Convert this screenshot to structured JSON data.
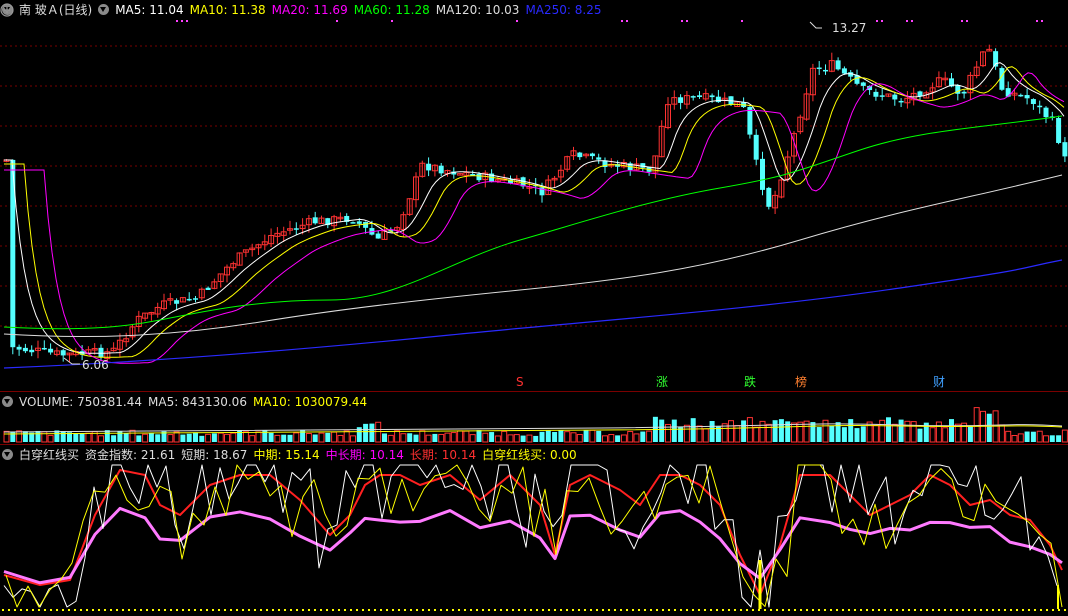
{
  "main": {
    "title": "南 玻Ａ(日线)",
    "ma": [
      {
        "label": "MA5: 11.04",
        "color": "#ffffff"
      },
      {
        "label": "MA10: 11.38",
        "color": "#ffff00"
      },
      {
        "label": "MA20: 11.69",
        "color": "#ff00ff"
      },
      {
        "label": "MA60: 11.28",
        "color": "#00ff00"
      },
      {
        "label": "MA120: 10.03",
        "color": "#dddddd"
      },
      {
        "label": "MA250: 8.25",
        "color": "#1a1aff"
      }
    ],
    "high_label": "13.27",
    "low_label": "6.06",
    "tags": [
      {
        "text": "S",
        "color": "#ff3030"
      },
      {
        "text": "涨",
        "color": "#30ff30"
      },
      {
        "text": "跌",
        "color": "#30ff30"
      },
      {
        "text": "榜",
        "color": "#ff8030"
      },
      {
        "text": "财",
        "color": "#40a0ff"
      }
    ],
    "icons": {
      "collapse": "chevron-down-icon",
      "settings": "expand-icon"
    }
  },
  "volume": {
    "items": [
      {
        "label": "VOLUME: 750381.44",
        "color": "#dddddd"
      },
      {
        "label": "MA5: 843130.06",
        "color": "#dddddd"
      },
      {
        "label": "MA10: 1030079.44",
        "color": "#ffff00"
      }
    ]
  },
  "indicator": {
    "items": [
      {
        "label": "白穿红线买",
        "color": "#dddddd"
      },
      {
        "label": "资金指数: 21.61",
        "color": "#dddddd"
      },
      {
        "label": "短期: 18.67",
        "color": "#dddddd"
      },
      {
        "label": "中期: 15.14",
        "color": "#ffff00"
      },
      {
        "label": "中长期: 10.14",
        "color": "#ff00ff"
      },
      {
        "label": "长期: 10.14",
        "color": "#ff3030"
      },
      {
        "label": "白穿红线买: 0.00",
        "color": "#ffff00"
      }
    ]
  },
  "colors": {
    "up": "#ff3232",
    "down": "#54ffff",
    "grid": "#7a0000",
    "background": "#000000"
  }
}
